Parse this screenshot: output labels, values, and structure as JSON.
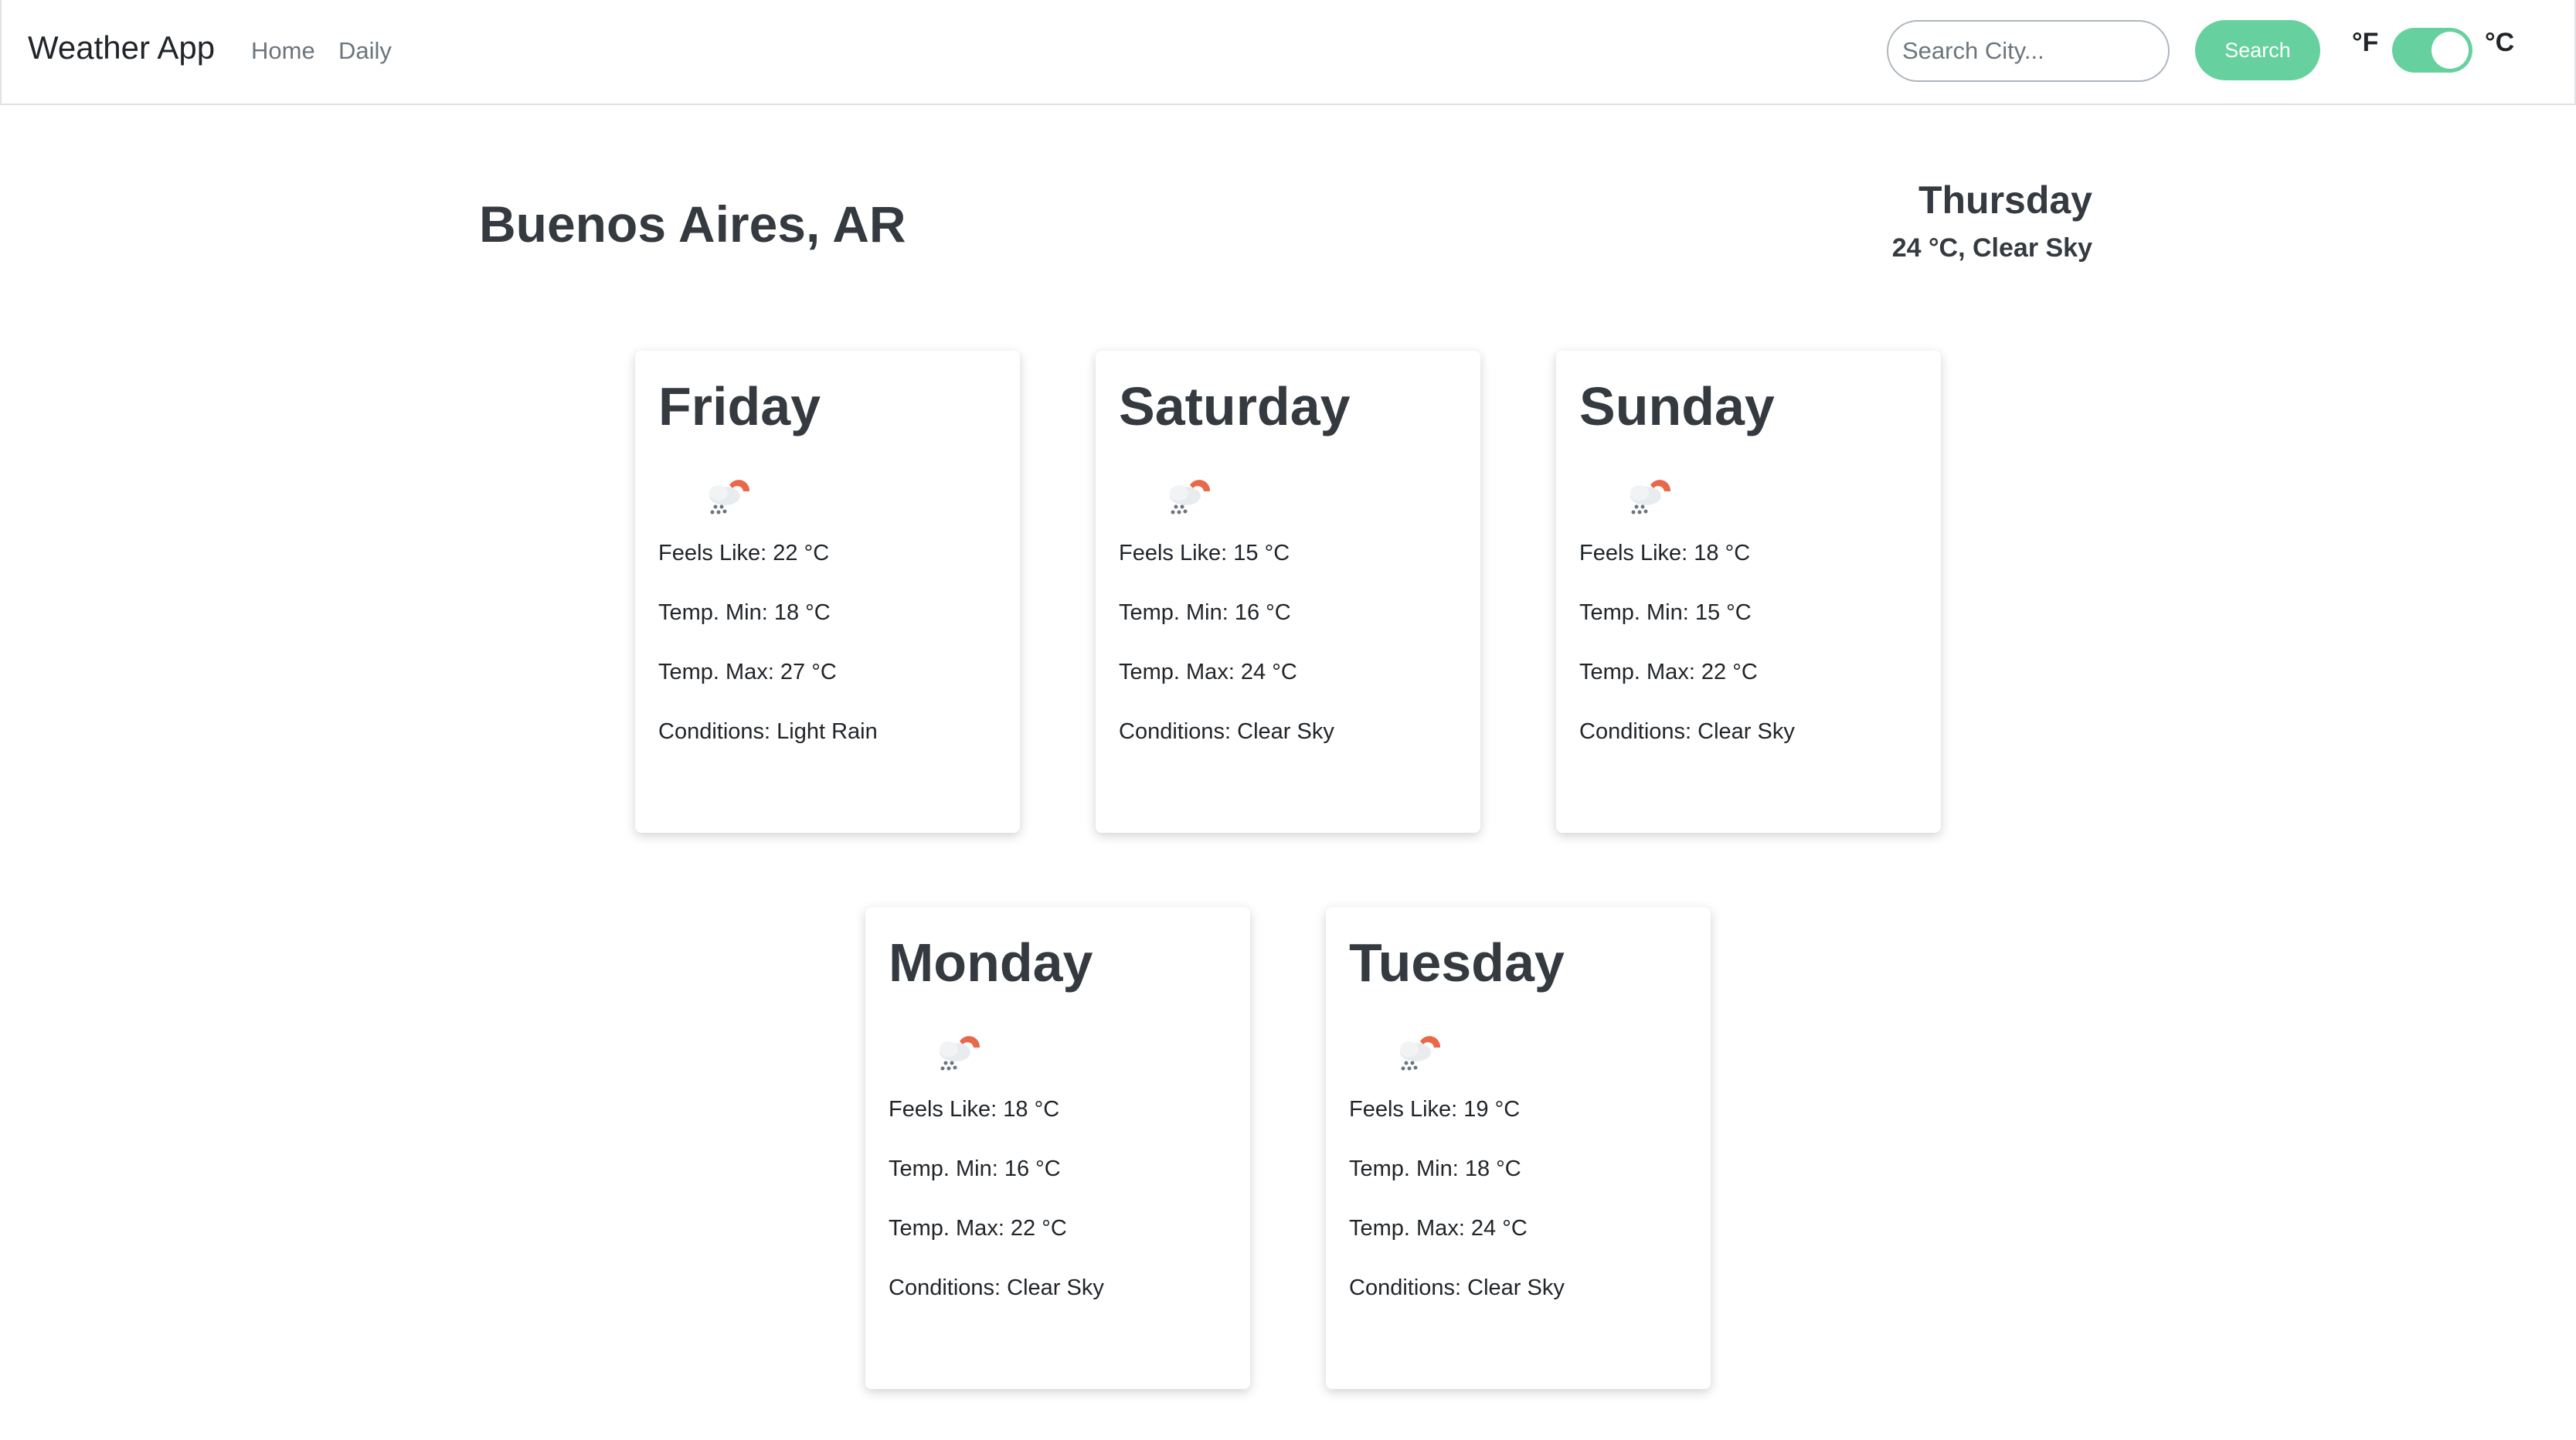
{
  "navbar": {
    "brand": "Weather App",
    "links": [
      "Home",
      "Daily"
    ],
    "search_placeholder": "Search City...",
    "search_button": "Search",
    "unit_f": "°F",
    "unit_c": "°C",
    "unit_toggle_on": true
  },
  "current": {
    "city": "Buenos Aires, AR",
    "day": "Thursday",
    "summary": "24 °C, Clear Sky"
  },
  "forecast": [
    {
      "day": "Friday",
      "feels_like": "Feels Like: 22 °C",
      "temp_min": "Temp. Min: 18 °C",
      "temp_max": "Temp. Max: 27 °C",
      "conditions": "Conditions: Light Rain",
      "icon": "rain-cloud-sun-icon"
    },
    {
      "day": "Saturday",
      "feels_like": "Feels Like: 15 °C",
      "temp_min": "Temp. Min: 16 °C",
      "temp_max": "Temp. Max: 24 °C",
      "conditions": "Conditions: Clear Sky",
      "icon": "rain-cloud-sun-icon"
    },
    {
      "day": "Sunday",
      "feels_like": "Feels Like: 18 °C",
      "temp_min": "Temp. Min: 15 °C",
      "temp_max": "Temp. Max: 22 °C",
      "conditions": "Conditions: Clear Sky",
      "icon": "rain-cloud-sun-icon"
    },
    {
      "day": "Monday",
      "feels_like": "Feels Like: 18 °C",
      "temp_min": "Temp. Min: 16 °C",
      "temp_max": "Temp. Max: 22 °C",
      "conditions": "Conditions: Clear Sky",
      "icon": "rain-cloud-sun-icon"
    },
    {
      "day": "Tuesday",
      "feels_like": "Feels Like: 19 °C",
      "temp_min": "Temp. Min: 18 °C",
      "temp_max": "Temp. Max: 24 °C",
      "conditions": "Conditions: Clear Sky",
      "icon": "rain-cloud-sun-icon"
    }
  ],
  "colors": {
    "accent": "#66d19e",
    "sun": "#e8684a",
    "cloud": "#e9ecef"
  }
}
